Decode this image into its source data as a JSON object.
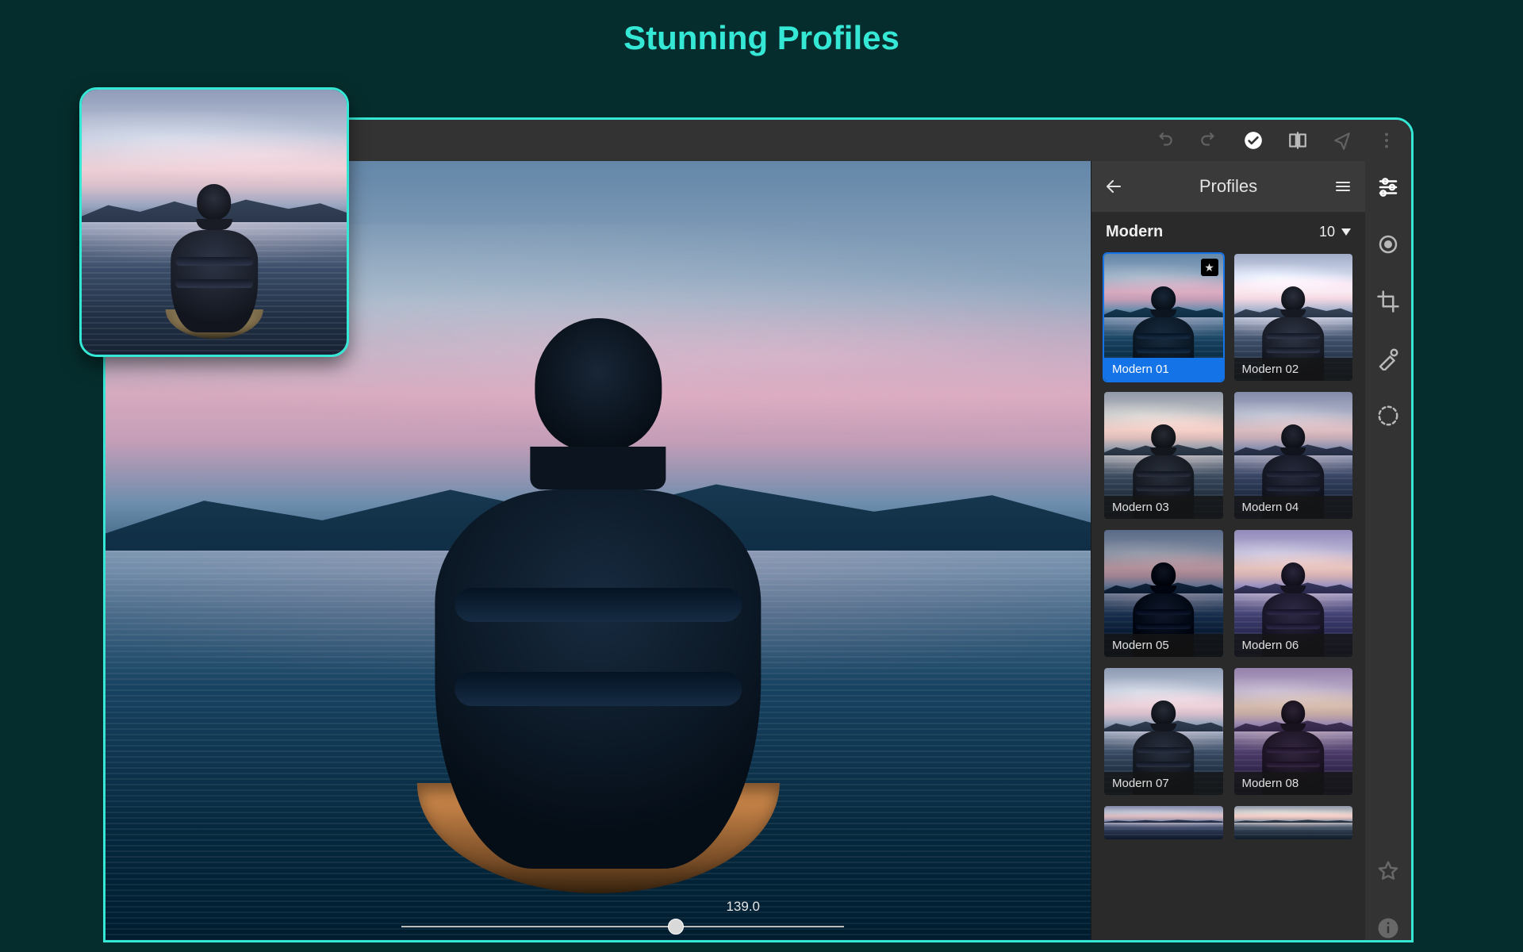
{
  "headline": "Stunning Profiles",
  "panel": {
    "title": "Profiles",
    "category": "Modern",
    "count": "10"
  },
  "slider": {
    "value": "139.0"
  },
  "profiles": [
    {
      "label": "Modern 01",
      "variant": "v-blue",
      "selected": true,
      "favorite": true
    },
    {
      "label": "Modern 02",
      "variant": "v-light",
      "selected": false,
      "favorite": false
    },
    {
      "label": "Modern 03",
      "variant": "v-warm",
      "selected": false,
      "favorite": false
    },
    {
      "label": "Modern 04",
      "variant": "v-cool",
      "selected": false,
      "favorite": false
    },
    {
      "label": "Modern 05",
      "variant": "v-dark",
      "selected": false,
      "favorite": false
    },
    {
      "label": "Modern 06",
      "variant": "v-teal",
      "selected": false,
      "favorite": false
    },
    {
      "label": "Modern 07",
      "variant": "v-soft",
      "selected": false,
      "favorite": false
    },
    {
      "label": "Modern 08",
      "variant": "v-green",
      "selected": false,
      "favorite": false
    }
  ],
  "colors": {
    "accent": "#35e8d6",
    "select": "#1473e6"
  }
}
